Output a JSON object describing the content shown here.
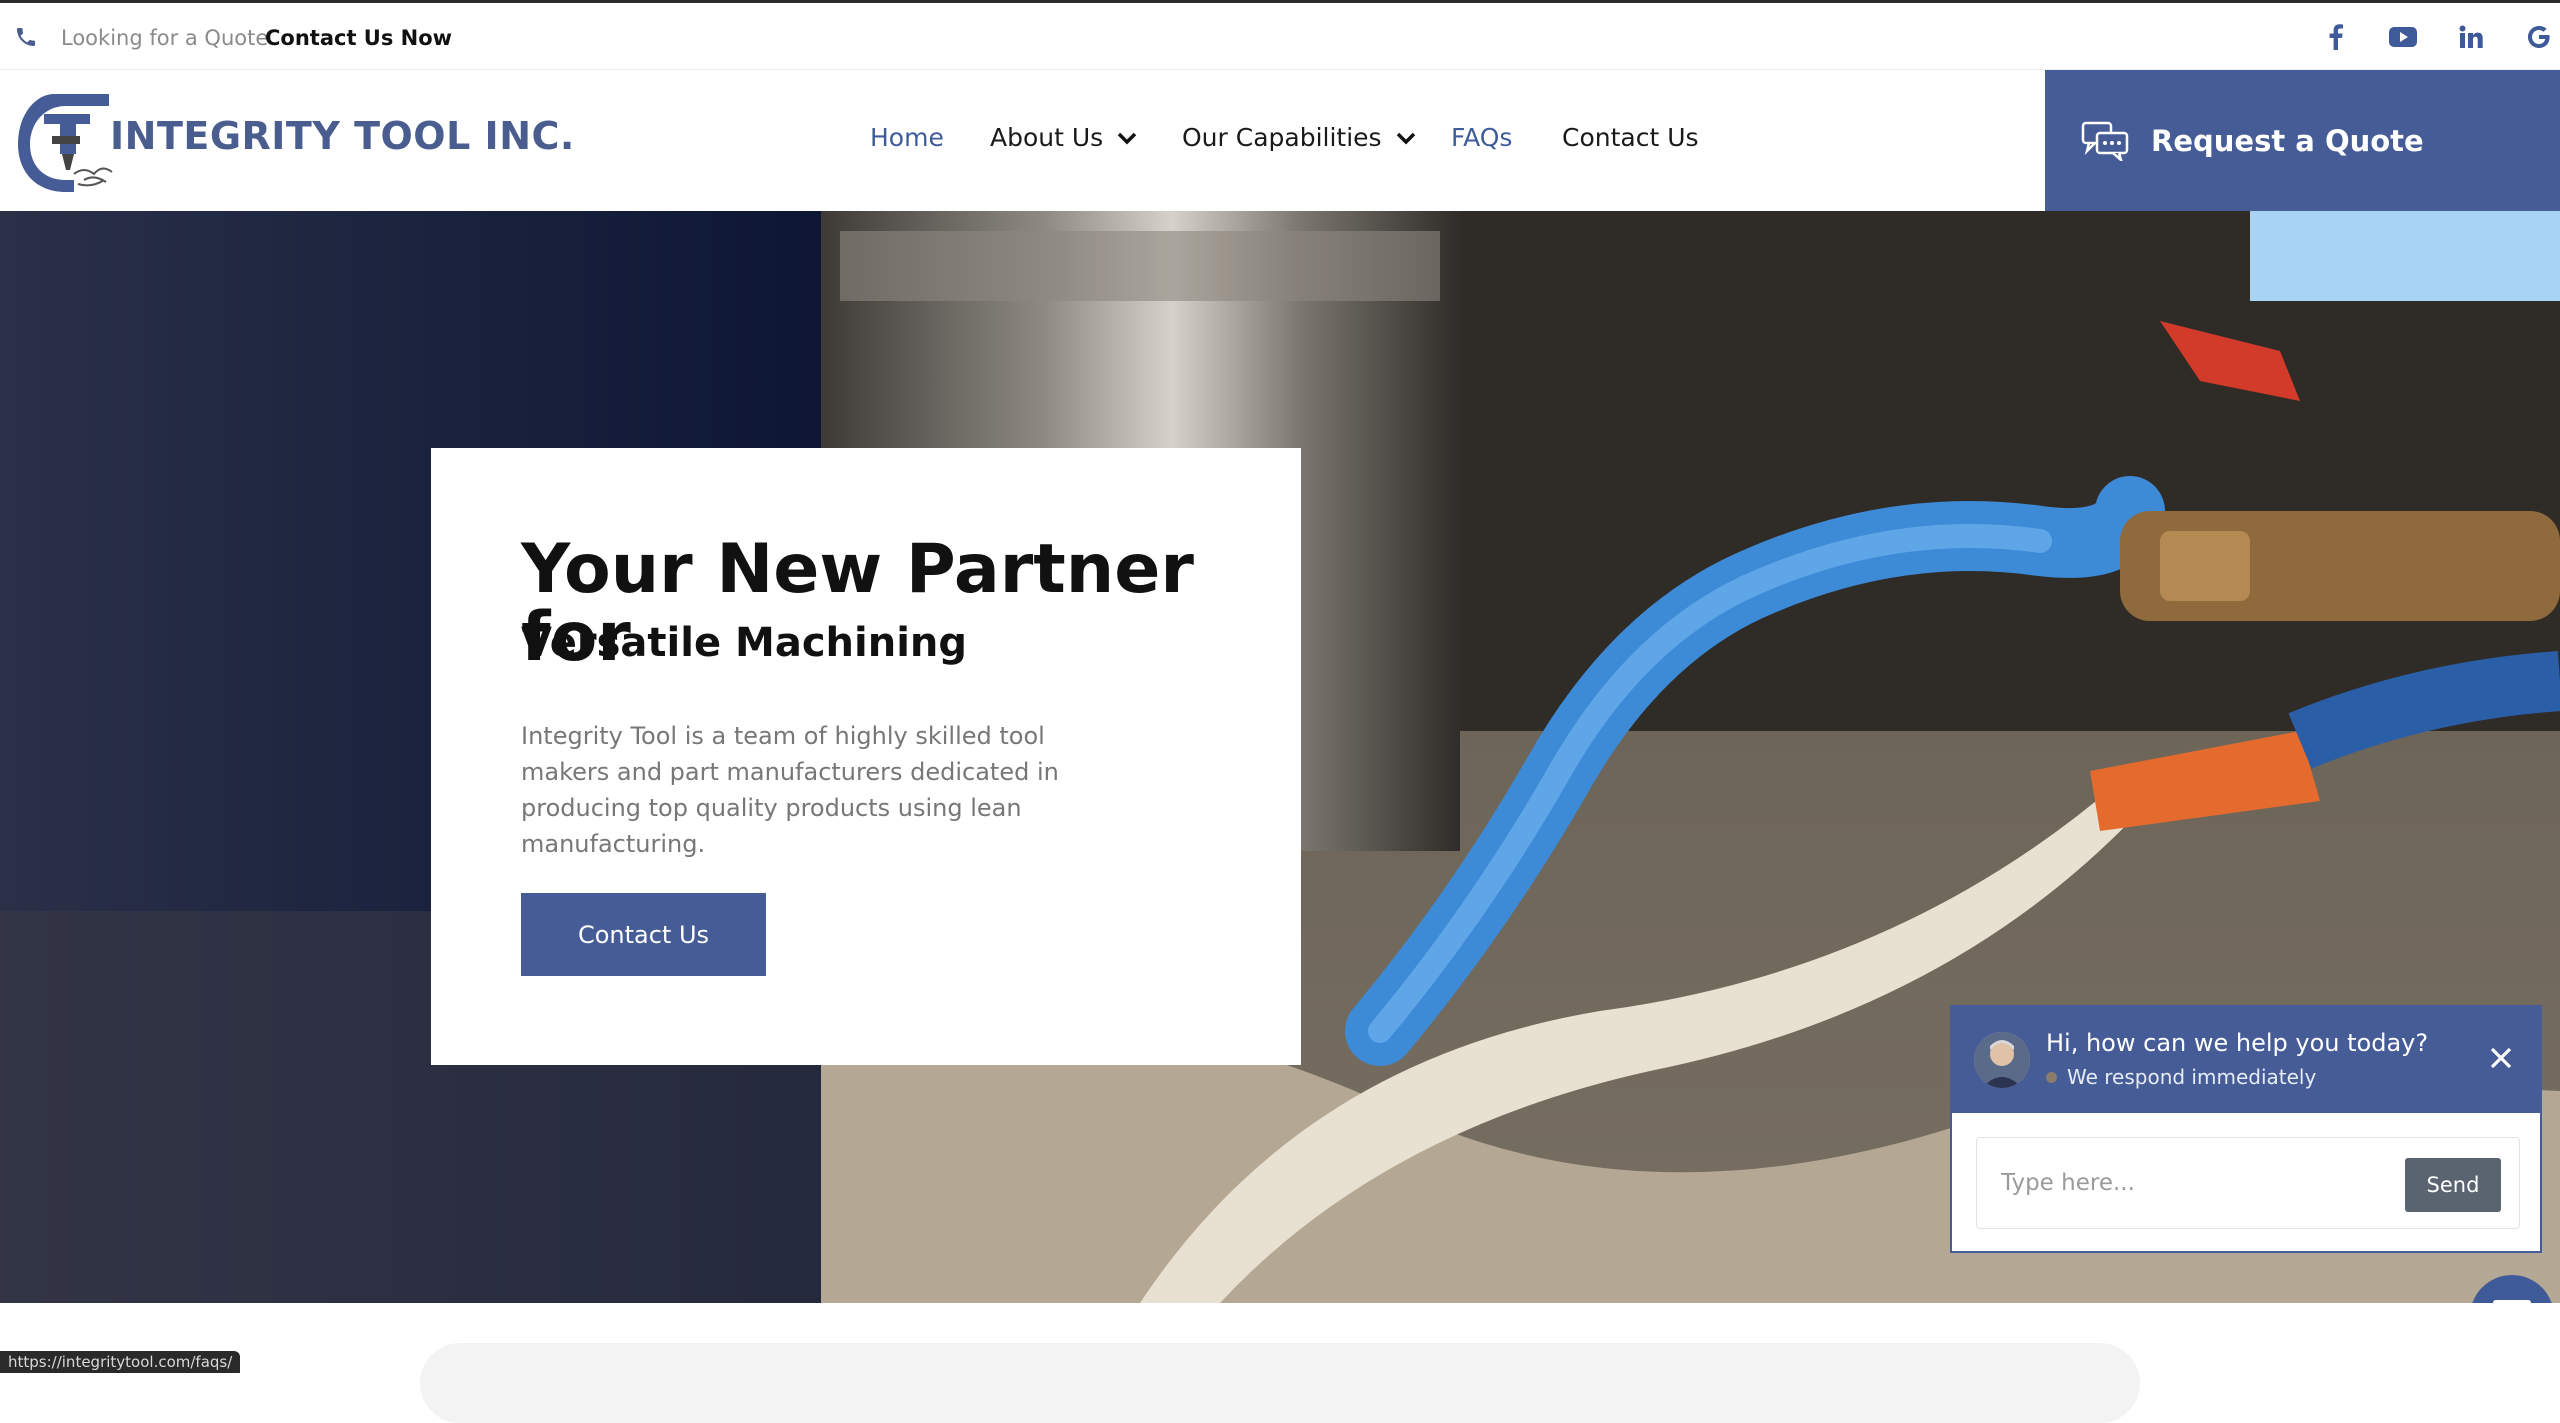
{
  "topbar": {
    "lead_text": "Looking for a Quote",
    "cta_text": "Contact Us Now",
    "social": [
      "facebook-icon",
      "youtube-icon",
      "linkedin-icon",
      "google-icon"
    ]
  },
  "header": {
    "logo_text": "INTEGRITY TOOL INC.",
    "nav": [
      {
        "label": "Home",
        "active": true,
        "dropdown": false
      },
      {
        "label": "About Us",
        "active": false,
        "dropdown": true
      },
      {
        "label": "Our Capabilities",
        "active": false,
        "dropdown": true
      },
      {
        "label": "FAQs",
        "active": false,
        "dropdown": false
      },
      {
        "label": "Contact Us",
        "active": false,
        "dropdown": false
      }
    ],
    "quote_label": "Request a Quote"
  },
  "hero": {
    "title": "Your New Partner for",
    "subtitle": "Versatile Machining",
    "body": "Integrity Tool is a team of highly skilled tool makers and part manufacturers dedicated in producing top quality products using lean manufacturing.",
    "button_label": "Contact Us"
  },
  "chat": {
    "greeting": "Hi, how can we help you today?",
    "status": "We respond immediately",
    "placeholder": "Type here...",
    "send_label": "Send"
  },
  "status_bar": {
    "url": "https://integritytool.com/faqs/"
  },
  "colors": {
    "brand": "#465c97",
    "active_nav": "#3f5c9a",
    "text_dark": "#111111",
    "text_muted": "#777777"
  }
}
